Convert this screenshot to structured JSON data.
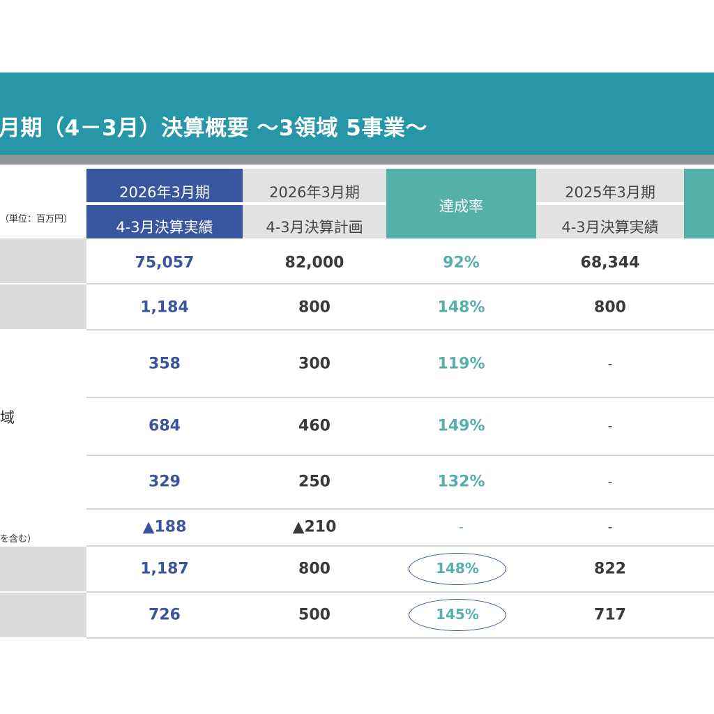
{
  "title": "月期（4－3月）決算概要 ～3領域 5事業～",
  "unit_label": "（単位：百万円）",
  "row_label_fragment": "域",
  "note_fragment": "を含む）",
  "headers": {
    "col_a": {
      "line1": "2026年3月期",
      "line2": "4-3月決算実績"
    },
    "col_b": {
      "line1": "2026年3月期",
      "line2": "4-3月決算計画"
    },
    "col_c": {
      "label": "達成率"
    },
    "col_d": {
      "line1": "2025年3月期",
      "line2": "4-3月決算実績"
    }
  },
  "rows": [
    {
      "a": "75,057",
      "b": "82,000",
      "c": "92%",
      "d": "68,344"
    },
    {
      "a": "1,184",
      "b": "800",
      "c": "148%",
      "d": "800"
    },
    {
      "a": "358",
      "b": "300",
      "c": "119%",
      "d": "-"
    },
    {
      "a": "684",
      "b": "460",
      "c": "149%",
      "d": "-"
    },
    {
      "a": "329",
      "b": "250",
      "c": "132%",
      "d": "-"
    },
    {
      "a": "▲188",
      "b": "▲210",
      "c": "-",
      "d": "-"
    },
    {
      "a": "1,187",
      "b": "800",
      "c": "148%",
      "d": "822"
    },
    {
      "a": "726",
      "b": "500",
      "c": "145%",
      "d": "717"
    }
  ],
  "colors": {
    "title_band": "#2796a8",
    "actual_header": "#3a55a0",
    "rate_header": "#55b0a8",
    "plan_header": "#e2e2e2",
    "highlight_circle": "#3a55a0"
  }
}
